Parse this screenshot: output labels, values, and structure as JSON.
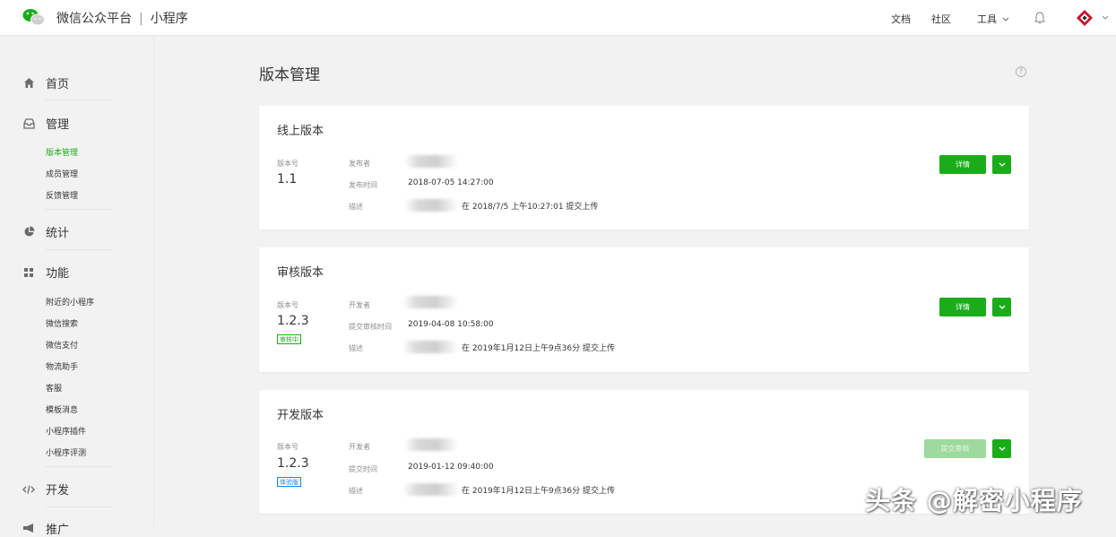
{
  "header": {
    "brand": "微信公众平台",
    "separator": "|",
    "product": "小程序",
    "links": {
      "docs": "文档",
      "community": "社区",
      "tools": "工具"
    }
  },
  "sidebar": {
    "groups": [
      {
        "label": "首页",
        "icon": "home-icon"
      },
      {
        "label": "管理",
        "icon": "inbox-icon",
        "items": [
          "版本管理",
          "成员管理",
          "反馈管理"
        ]
      },
      {
        "label": "统计",
        "icon": "pie-chart-icon"
      },
      {
        "label": "功能",
        "icon": "grid-icon",
        "items": [
          "附近的小程序",
          "微信搜索",
          "微信支付",
          "物流助手",
          "客服",
          "模板消息",
          "小程序插件",
          "小程序评测"
        ]
      },
      {
        "label": "开发",
        "icon": "code-icon"
      },
      {
        "label": "推广",
        "icon": "megaphone-icon"
      }
    ],
    "active_item": "版本管理"
  },
  "page": {
    "title": "版本管理",
    "help": "?"
  },
  "cards": {
    "online": {
      "title": "线上版本",
      "version_label": "版本号",
      "version": "1.1",
      "publisher_label": "发布者",
      "time_label": "发布时间",
      "time": "2018-07-05 14:27:00",
      "desc_label": "描述",
      "desc": "在 2018/7/5 上午10:27:01 提交上传",
      "detail_button": "详情"
    },
    "review": {
      "title": "审核版本",
      "version_label": "版本号",
      "version": "1.2.3",
      "status_tag": "审核中",
      "developer_label": "开发者",
      "time_label": "提交审核时间",
      "time": "2019-04-08 10:58:00",
      "desc_label": "描述",
      "desc": "在 2019年1月12日上午9点36分 提交上传",
      "detail_button": "详情"
    },
    "dev": {
      "title": "开发版本",
      "version_label": "版本号",
      "version": "1.2.3",
      "status_tag": "体验版",
      "developer_label": "开发者",
      "time_label": "提交时间",
      "time": "2019-01-12 09:40:00",
      "desc_label": "描述",
      "desc": "在 2019年1月12日上午9点36分 提交上传",
      "submit_button": "提交审核"
    }
  },
  "watermark": "头条 @解密小程序",
  "colors": {
    "accent": "#1aad19",
    "accent_disabled": "#9ed99d",
    "tag_blue": "#1485ee"
  }
}
